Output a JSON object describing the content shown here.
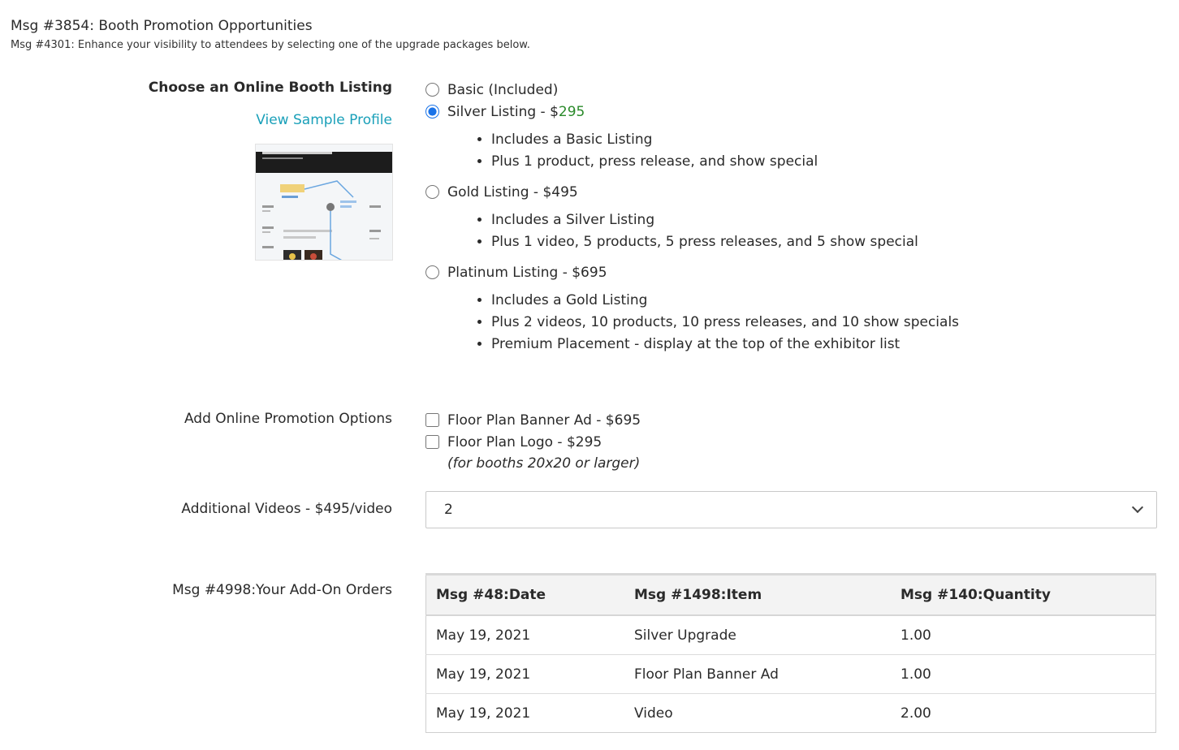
{
  "header": {
    "title": "Msg #3854: Booth Promotion Opportunities",
    "subtitle": "Msg #4301: Enhance your visibility to attendees by selecting one of the upgrade packages below."
  },
  "listing": {
    "label": "Choose an Online Booth Listing",
    "sample_link": "View Sample Profile",
    "options": [
      {
        "label": "Basic (Included)",
        "selected": false,
        "bullets": []
      },
      {
        "label": "Silver Listing - $",
        "price": "295",
        "selected": true,
        "bullets": [
          "Includes a Basic Listing",
          "Plus 1 product, press release, and show special"
        ]
      },
      {
        "label": "Gold Listing - $495",
        "selected": false,
        "bullets": [
          "Includes a Silver Listing",
          "Plus 1 video, 5 products, 5 press releases, and 5 show special"
        ]
      },
      {
        "label": "Platinum Listing - $695",
        "selected": false,
        "bullets": [
          "Includes a Gold Listing",
          "Plus 2 videos, 10 products, 10 press releases, and 10 show specials",
          "Premium Placement - display at the top of the exhibitor list"
        ]
      }
    ]
  },
  "promotion": {
    "label": "Add Online Promotion Options",
    "options": [
      {
        "label": "Floor Plan Banner Ad - $695",
        "checked": false
      },
      {
        "label": "Floor Plan Logo - $295",
        "checked": false
      }
    ],
    "note": "(for booths 20x20 or larger)"
  },
  "videos": {
    "label": "Additional Videos - $495/video",
    "selected": "2"
  },
  "orders": {
    "label": "Msg #4998:Your Add-On Orders",
    "columns": [
      "Msg #48:Date",
      "Msg #1498:Item",
      "Msg #140:Quantity"
    ],
    "rows": [
      [
        "May 19, 2021",
        "Silver Upgrade",
        "1.00"
      ],
      [
        "May 19, 2021",
        "Floor Plan Banner Ad",
        "1.00"
      ],
      [
        "May 19, 2021",
        "Video",
        "2.00"
      ]
    ]
  },
  "colors": {
    "link": "#1aa0b9",
    "price_highlight": "#2a8a2a",
    "radio_accent": "#1a73e8"
  }
}
